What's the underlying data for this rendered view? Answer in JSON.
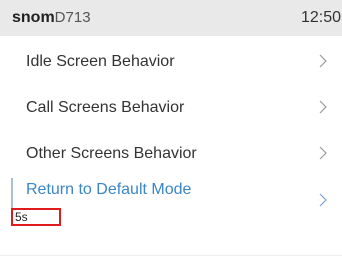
{
  "status_bar": {
    "brand": "snom",
    "model": "D713",
    "time": "12:50"
  },
  "menu": {
    "items": [
      {
        "label": "Idle Screen Behavior",
        "chevron": "chevron-right-icon"
      },
      {
        "label": "Call Screens Behavior",
        "chevron": "chevron-right-icon"
      },
      {
        "label": "Other Screens Behavior",
        "chevron": "chevron-right-icon"
      },
      {
        "label": "Return to Default Mode",
        "value": "5s",
        "selected": true,
        "chevron": "chevron-right-icon"
      }
    ]
  },
  "colors": {
    "status_bar_bg": "#e9e9e9",
    "selected_text": "#3a86c8",
    "highlight_border": "#e01b1b",
    "chevron": "#9a9a9a"
  }
}
